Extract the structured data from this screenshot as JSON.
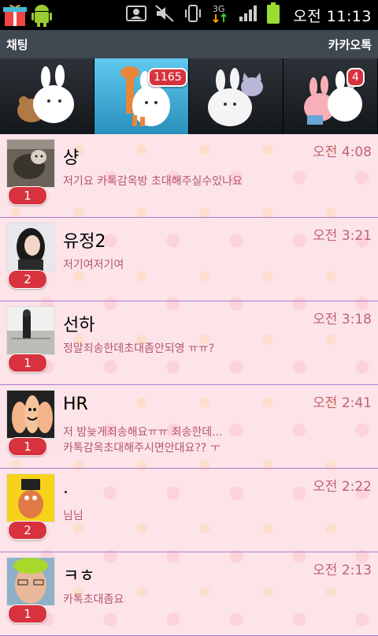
{
  "status_bar": {
    "time": "오전 11:13",
    "network": "3G"
  },
  "header": {
    "title": "채팅",
    "app_name": "카카오톡"
  },
  "tabs": [
    {
      "badge": ""
    },
    {
      "badge": "1165"
    },
    {
      "badge": ""
    },
    {
      "badge": "4"
    }
  ],
  "chats": [
    {
      "name": "샹",
      "time": "오전 4:08",
      "message": "저기요 카톡감옥방 초대해주실수있나요",
      "unread": "1"
    },
    {
      "name": "유정2",
      "time": "오전 3:21",
      "message": "저기여저기여",
      "unread": "2"
    },
    {
      "name": "선하",
      "time": "오전 3:18",
      "message": "정말죄송한데초대좀안되영 ㅠㅠ?",
      "unread": "1"
    },
    {
      "name": "HR",
      "time": "오전 2:41",
      "message": "저 밤늦게죄송해요ㅠㅠ 죄송한데...\n카톡감옥초대해주시면안대요?? ㅜ",
      "unread": "1"
    },
    {
      "name": ".",
      "time": "오전 2:22",
      "message": "님님",
      "unread": "2"
    },
    {
      "name": "ㅋㅎ",
      "time": "오전 2:13",
      "message": "카톡초대좀요",
      "unread": "1"
    }
  ]
}
